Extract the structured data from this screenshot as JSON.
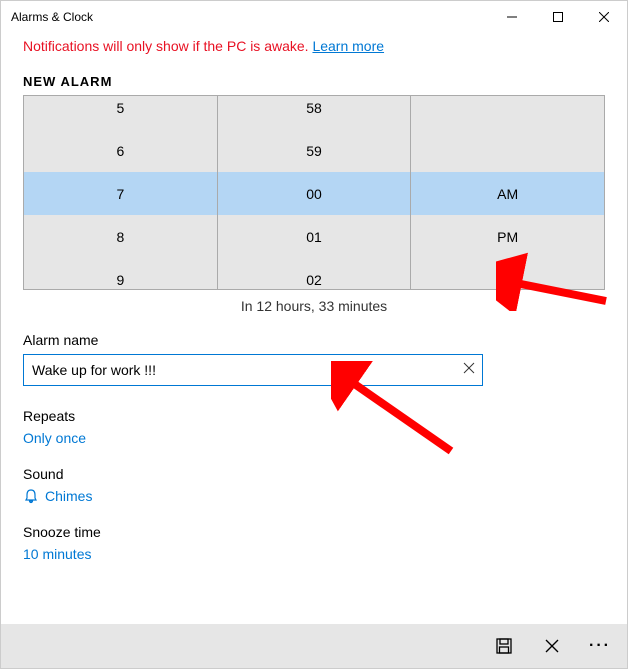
{
  "window": {
    "title": "Alarms & Clock"
  },
  "notification": {
    "text": "Notifications will only show if the PC is awake. ",
    "link": "Learn more"
  },
  "header": "NEW ALARM",
  "timepicker": {
    "hours": [
      "5",
      "6",
      "7",
      "8",
      "9"
    ],
    "minutes": [
      "58",
      "59",
      "00",
      "01",
      "02"
    ],
    "ampm": [
      "",
      "",
      "AM",
      "PM",
      ""
    ]
  },
  "time_until": "In 12 hours, 33 minutes",
  "alarm_name": {
    "label": "Alarm name",
    "value": "Wake up for work !!!"
  },
  "repeats": {
    "label": "Repeats",
    "value": "Only once"
  },
  "sound": {
    "label": "Sound",
    "value": "Chimes"
  },
  "snooze": {
    "label": "Snooze time",
    "value": "10 minutes"
  }
}
